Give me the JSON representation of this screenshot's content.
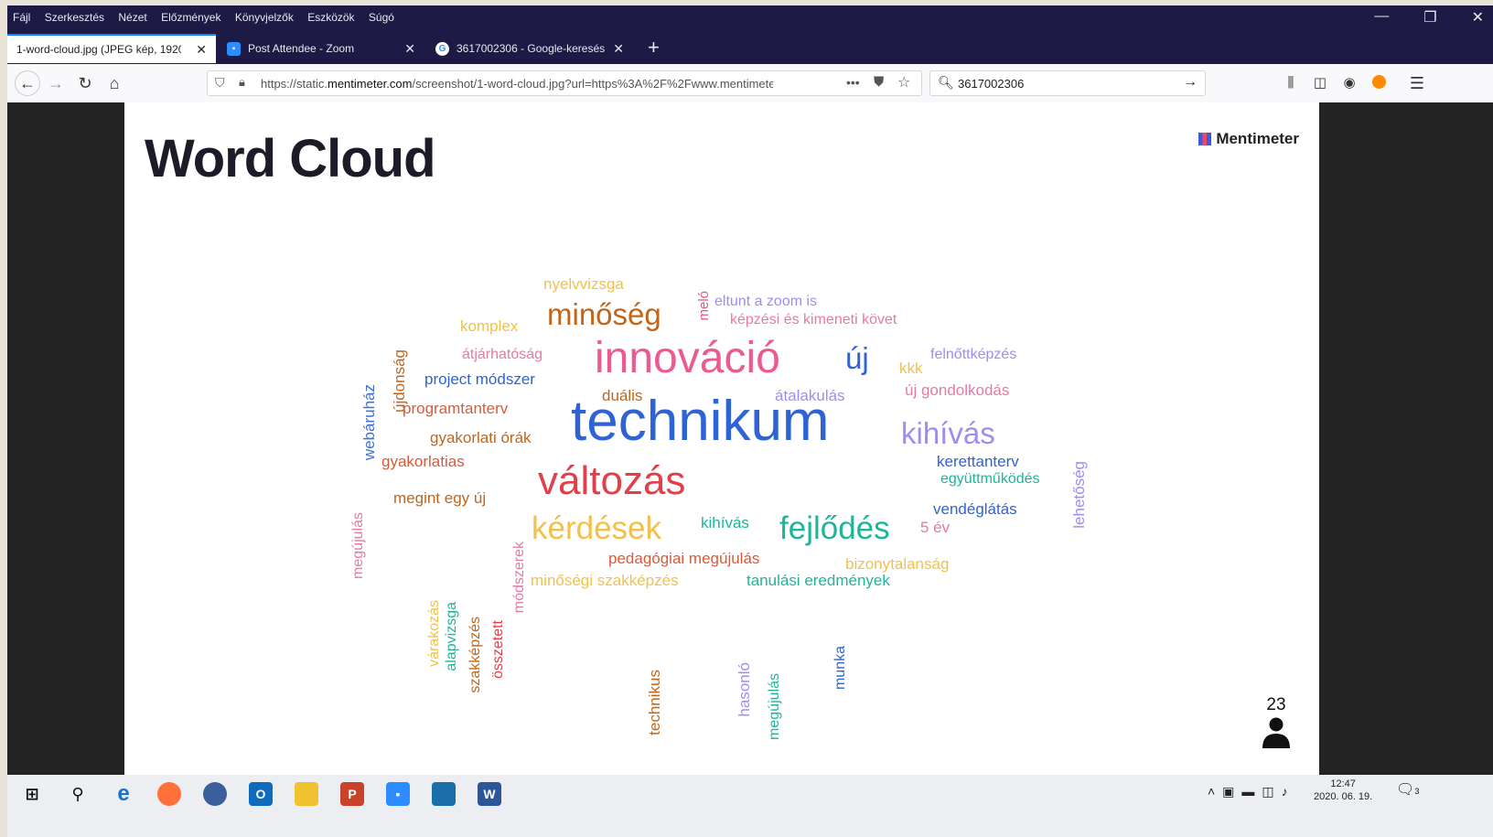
{
  "menubar": {
    "items": [
      "Fájl",
      "Szerkesztés",
      "Nézet",
      "Előzmények",
      "Könyvjelzők",
      "Eszközök",
      "Súgó"
    ],
    "window_controls": [
      "—",
      "❐",
      "✕"
    ]
  },
  "tabs": [
    {
      "label": "1-word-cloud.jpg (JPEG kép, 1920",
      "active": true
    },
    {
      "label": "Post Attendee - Zoom",
      "active": false
    },
    {
      "label": "3617002306 - Google-keresés",
      "active": false
    }
  ],
  "navbar": {
    "url_prefix": "https://static.",
    "url_domain": "mentimeter.com",
    "url_rest": "/screenshot/1-word-cloud.jpg?url=https%3A%2F%2Fwww.mentimeter",
    "search_value": "3617002306"
  },
  "slide": {
    "title": "Word Cloud",
    "brand": "Mentimeter",
    "participant_count": "23"
  },
  "words": [
    {
      "text": "nyelvvizsga",
      "color": "#f3c04a"
    },
    {
      "text": "meló",
      "color": "#e05a87"
    },
    {
      "text": "eltunt a zoom is",
      "color": "#9c8ef0"
    },
    {
      "text": "minőség",
      "color": "#c2651a"
    },
    {
      "text": "képzési és kimeneti követ",
      "color": "#e57aa5"
    },
    {
      "text": "komplex",
      "color": "#f3c04a"
    },
    {
      "text": "újdonság",
      "color": "#c2651a"
    },
    {
      "text": "webáruház",
      "color": "#3d6fd8"
    },
    {
      "text": "átjárhatóság",
      "color": "#e57aa5"
    },
    {
      "text": "innováció",
      "color": "#ea5b92"
    },
    {
      "text": "új",
      "color": "#2e63d6"
    },
    {
      "text": "kkk",
      "color": "#f3c04a"
    },
    {
      "text": "felnőttképzés",
      "color": "#9c8ef0"
    },
    {
      "text": "project módszer",
      "color": "#2e63d6"
    },
    {
      "text": "duális",
      "color": "#c2651a"
    },
    {
      "text": "átalakulás",
      "color": "#9c8ef0"
    },
    {
      "text": "új gondolkodás",
      "color": "#e57aa5"
    },
    {
      "text": "lehetőség",
      "color": "#9c8ef0"
    },
    {
      "text": "programtanterv",
      "color": "#d95a3a"
    },
    {
      "text": "technikum",
      "color": "#2e63d6"
    },
    {
      "text": "kihívás",
      "color": "#9c8ef0"
    },
    {
      "text": "gyakorlati órák",
      "color": "#c2651a"
    },
    {
      "text": "megújulás",
      "color": "#e57aa5"
    },
    {
      "text": "gyakorlatias",
      "color": "#d95a3a"
    },
    {
      "text": "kerettanterv",
      "color": "#2e63d6"
    },
    {
      "text": "együttműködés",
      "color": "#1fb59a"
    },
    {
      "text": "változás",
      "color": "#e23f48"
    },
    {
      "text": "módszerek",
      "color": "#e57aa5"
    },
    {
      "text": "megint egy új",
      "color": "#c2651a"
    },
    {
      "text": "vendéglátás",
      "color": "#2e63d6"
    },
    {
      "text": "kérdések",
      "color": "#f3c04a"
    },
    {
      "text": "kihívás",
      "color": "#1fb59a"
    },
    {
      "text": "fejlődés",
      "color": "#1fb59a"
    },
    {
      "text": "5 év",
      "color": "#e57aa5"
    },
    {
      "text": "várakozás",
      "color": "#f3c04a"
    },
    {
      "text": "alapvizsga",
      "color": "#1fb59a"
    },
    {
      "text": "szakképzés",
      "color": "#c2651a"
    },
    {
      "text": "összetett",
      "color": "#e23f48"
    },
    {
      "text": "pedagógiai megújulás",
      "color": "#d95a3a"
    },
    {
      "text": "bizonytalanság",
      "color": "#f3c04a"
    },
    {
      "text": "minőségi szakképzés",
      "color": "#f3c04a"
    },
    {
      "text": "tanulási eredmények",
      "color": "#1fb59a"
    },
    {
      "text": "technikus",
      "color": "#c2651a"
    },
    {
      "text": "hasonló",
      "color": "#9c8ef0"
    },
    {
      "text": "megújulás",
      "color": "#1fb59a"
    },
    {
      "text": "munka",
      "color": "#2e63d6"
    }
  ],
  "taskbar": {
    "time": "12:47",
    "date": "2020. 06. 19.",
    "notification_count": "3"
  }
}
